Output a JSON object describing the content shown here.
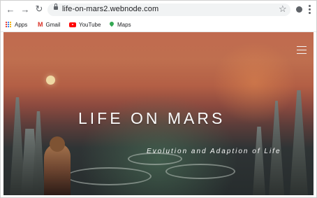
{
  "browser": {
    "nav": {
      "back_icon": "←",
      "forward_icon": "→",
      "reload_icon": "↻"
    },
    "address": {
      "url": "life-on-mars2.webnode.com",
      "lock_icon": "lock-icon"
    },
    "toolbar": {
      "star_icon": "☆",
      "extension_icon": "extension-icon",
      "menu_icon": "menu-icon"
    },
    "bookmarks": [
      {
        "label": "Apps",
        "icon": "apps-icon"
      },
      {
        "label": "Gmail",
        "icon": "gmail-icon"
      },
      {
        "label": "YouTube",
        "icon": "youtube-icon"
      },
      {
        "label": "Maps",
        "icon": "maps-icon"
      }
    ]
  },
  "page": {
    "title": "LIFE ON MARS",
    "subtitle": "Evolution and Adaption of Life",
    "menu_icon": "hamburger-icon"
  }
}
